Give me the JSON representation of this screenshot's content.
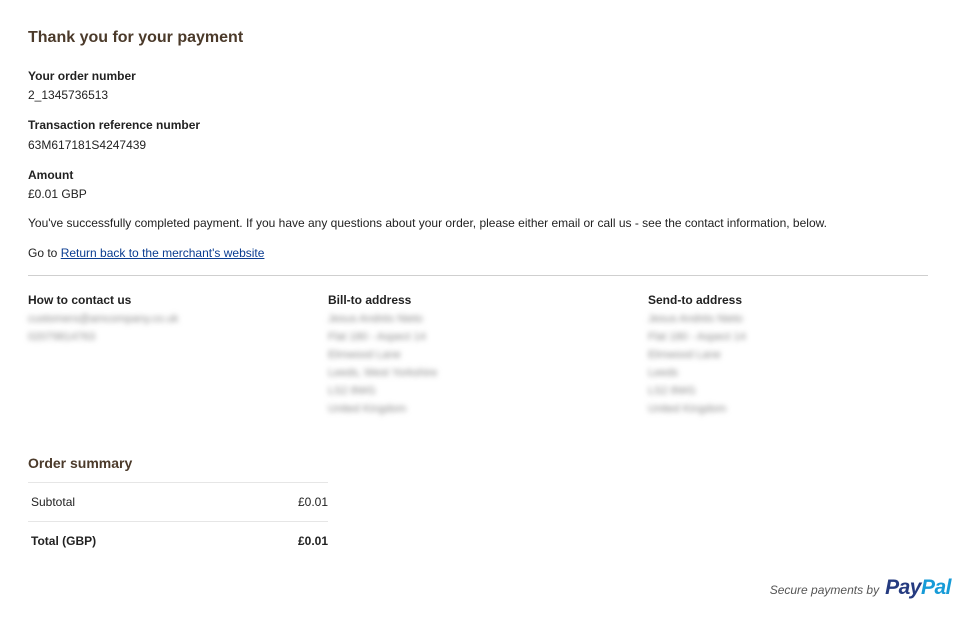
{
  "header": {
    "title": "Thank you for your payment"
  },
  "order": {
    "number_label": "Your order number",
    "number_value": "2_1345736513",
    "transaction_label": "Transaction reference number",
    "transaction_value": "63M617181S4247439",
    "amount_label": "Amount",
    "amount_value": "£0.01 GBP"
  },
  "message": "You've successfully completed payment. If you have any questions about your order, please either email or call us - see the contact information, below.",
  "goto": {
    "prefix": "Go to ",
    "link_text": "Return back to the merchant's website"
  },
  "contact": {
    "heading": "How to contact us",
    "lines": [
      "customers@amcompany.co.uk",
      "02079814763"
    ]
  },
  "bill_to": {
    "heading": "Bill-to address",
    "lines": [
      "Jesus Andrés Nieto",
      "Flat 180 - Aspect 14",
      "Elmwood Lane",
      "Leeds, West Yorkshire",
      "LS2 8WG",
      "United Kingdom"
    ]
  },
  "send_to": {
    "heading": "Send-to address",
    "lines": [
      "Jesus Andrés Nieto",
      "Flat 180 - Aspect 14",
      "Elmwood Lane",
      "Leeds",
      "LS2 8WG",
      "United Kingdom"
    ]
  },
  "summary": {
    "title": "Order summary",
    "rows": [
      {
        "label": "Subtotal",
        "amount": "£0.01"
      },
      {
        "label": "Total (GBP)",
        "amount": "£0.01"
      }
    ]
  },
  "footer": {
    "text": "Secure payments by",
    "logo_part1": "Pay",
    "logo_part2": "Pal"
  },
  "colors": {
    "heading": "#4b3a2a",
    "link": "#0b3d91",
    "paypal_dark": "#253b80",
    "paypal_light": "#179bd7"
  }
}
